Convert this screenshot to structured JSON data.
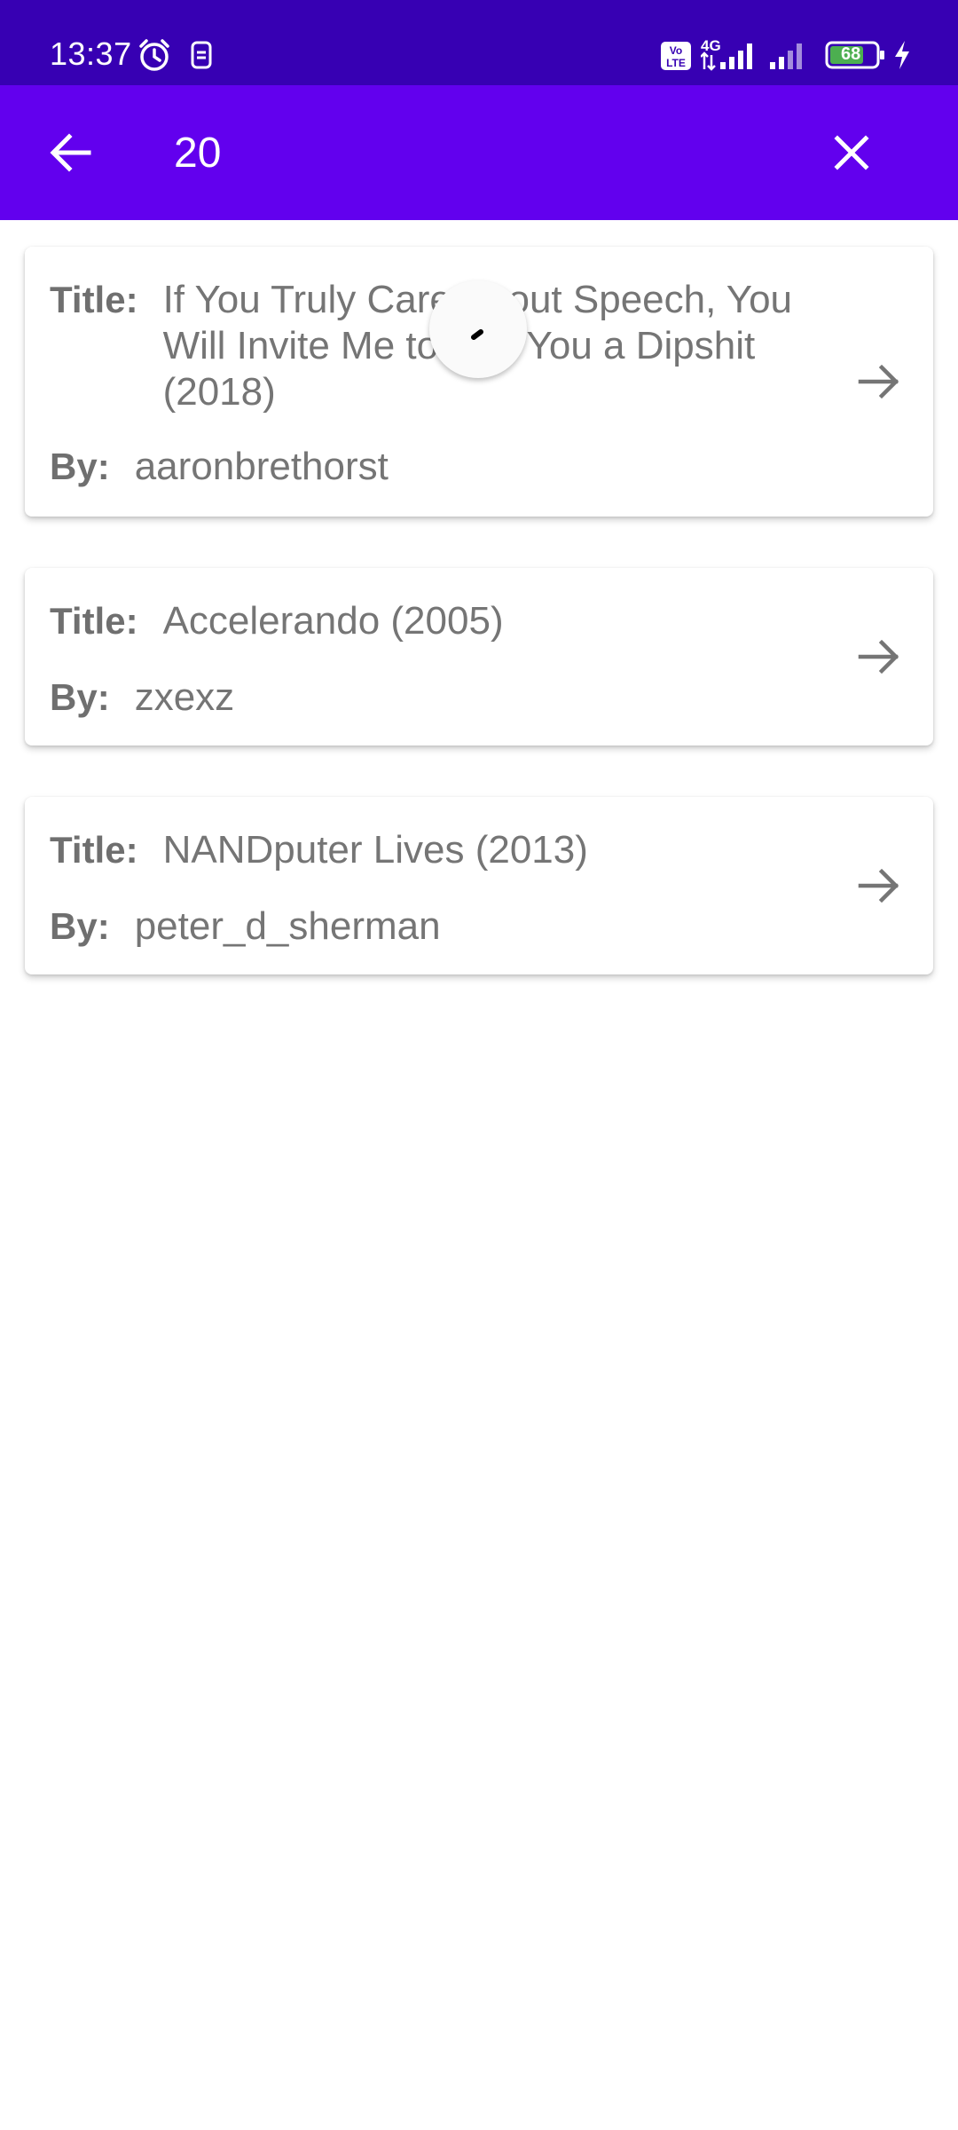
{
  "status_bar": {
    "time": "13:37",
    "battery": "68",
    "network": "4G",
    "icons": [
      "alarm-icon",
      "sim-icon",
      "volte-icon",
      "signal-icon",
      "signal-icon-2",
      "battery-icon",
      "charging-icon"
    ]
  },
  "app_bar": {
    "search_value": "20",
    "background": "#6200EE",
    "status_background": "#3700B3"
  },
  "results": [
    {
      "title_label": "Title:",
      "title": "If You Truly Care About Speech, You Will Invite Me to Call You a Dipshit (2018)",
      "by_label": "By:",
      "author": "aaronbrethorst"
    },
    {
      "title_label": "Title:",
      "title": "Accelerando (2005)",
      "by_label": "By:",
      "author": "zxexz"
    },
    {
      "title_label": "Title:",
      "title": "NANDputer Lives (2013)",
      "by_label": "By:",
      "author": "peter_d_sherman"
    }
  ]
}
